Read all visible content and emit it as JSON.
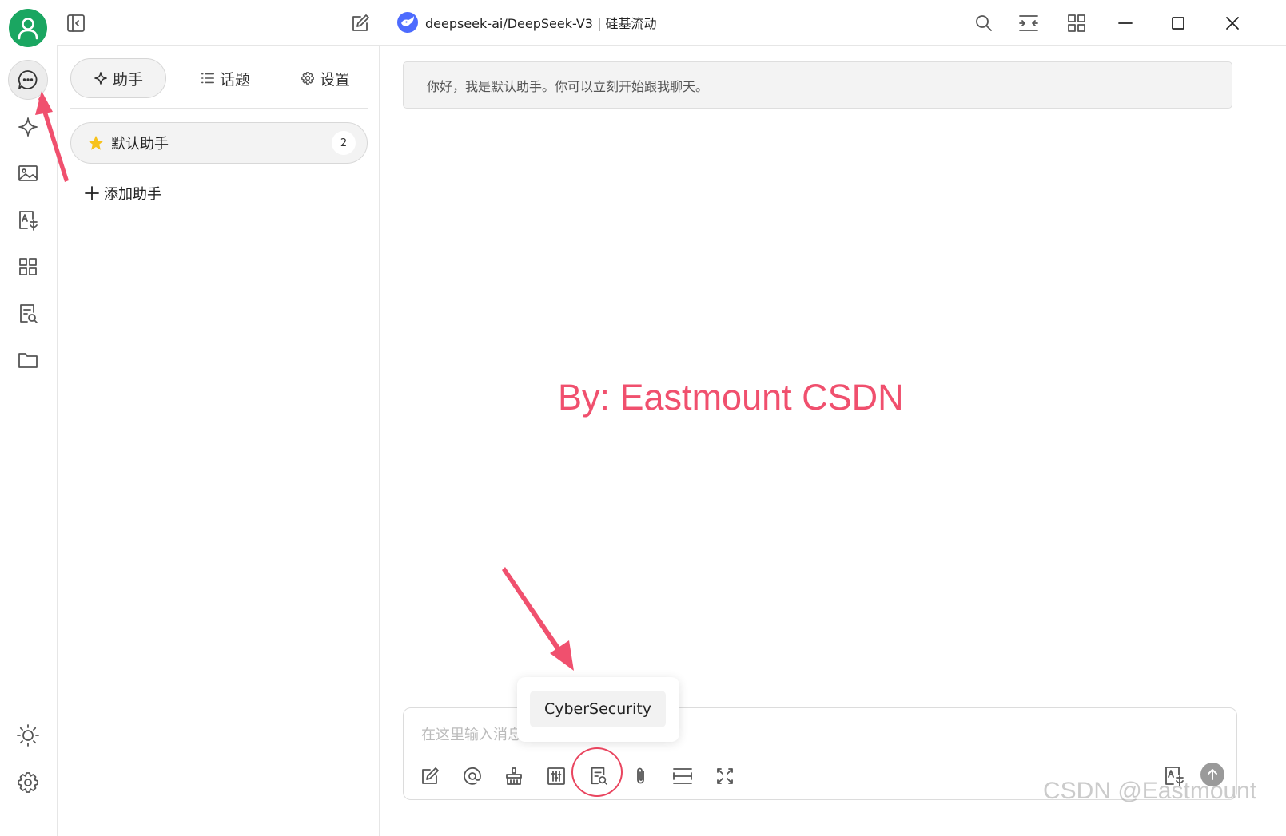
{
  "window": {
    "title": "deepseek-ai/DeepSeek-V3 | 硅基流动",
    "controls": [
      "search-icon",
      "move-icon",
      "grid-icon",
      "minimize-icon",
      "maximize-icon",
      "close-icon"
    ]
  },
  "rail": {
    "items": [
      "chat-icon",
      "sparkle-icon",
      "image-icon",
      "translate-icon",
      "apps-icon",
      "knowledge-icon",
      "folder-icon"
    ],
    "bottom": [
      "theme-icon",
      "settings-icon"
    ],
    "active": "chat-icon"
  },
  "sidebar": {
    "tabs": [
      {
        "label": "助手",
        "icon": "sparkle-icon",
        "active": true
      },
      {
        "label": "话题",
        "icon": "list-icon",
        "active": false
      },
      {
        "label": "设置",
        "icon": "gear-icon",
        "active": false
      }
    ],
    "assistant": {
      "label": "默认助手",
      "icon": "star-icon",
      "count": "2"
    },
    "add_label": "添加助手"
  },
  "chat": {
    "welcome": "你好，我是默认助手。你可以立刻开始跟我聊天。"
  },
  "overlay": {
    "by_text": "By: Eastmount CSDN",
    "csdn_watermark": "CSDN @Eastmount",
    "accent": "#f0506e"
  },
  "input": {
    "placeholder": "在这里输入消息",
    "tools": [
      "edit-icon",
      "mention-icon",
      "clear-icon",
      "tune-icon",
      "knowledge-icon",
      "attach-icon",
      "divider-icon",
      "expand-icon"
    ],
    "right_tools": [
      "translate-icon",
      "send-icon"
    ]
  },
  "kb_popup": {
    "option": "CyberSecurity"
  }
}
